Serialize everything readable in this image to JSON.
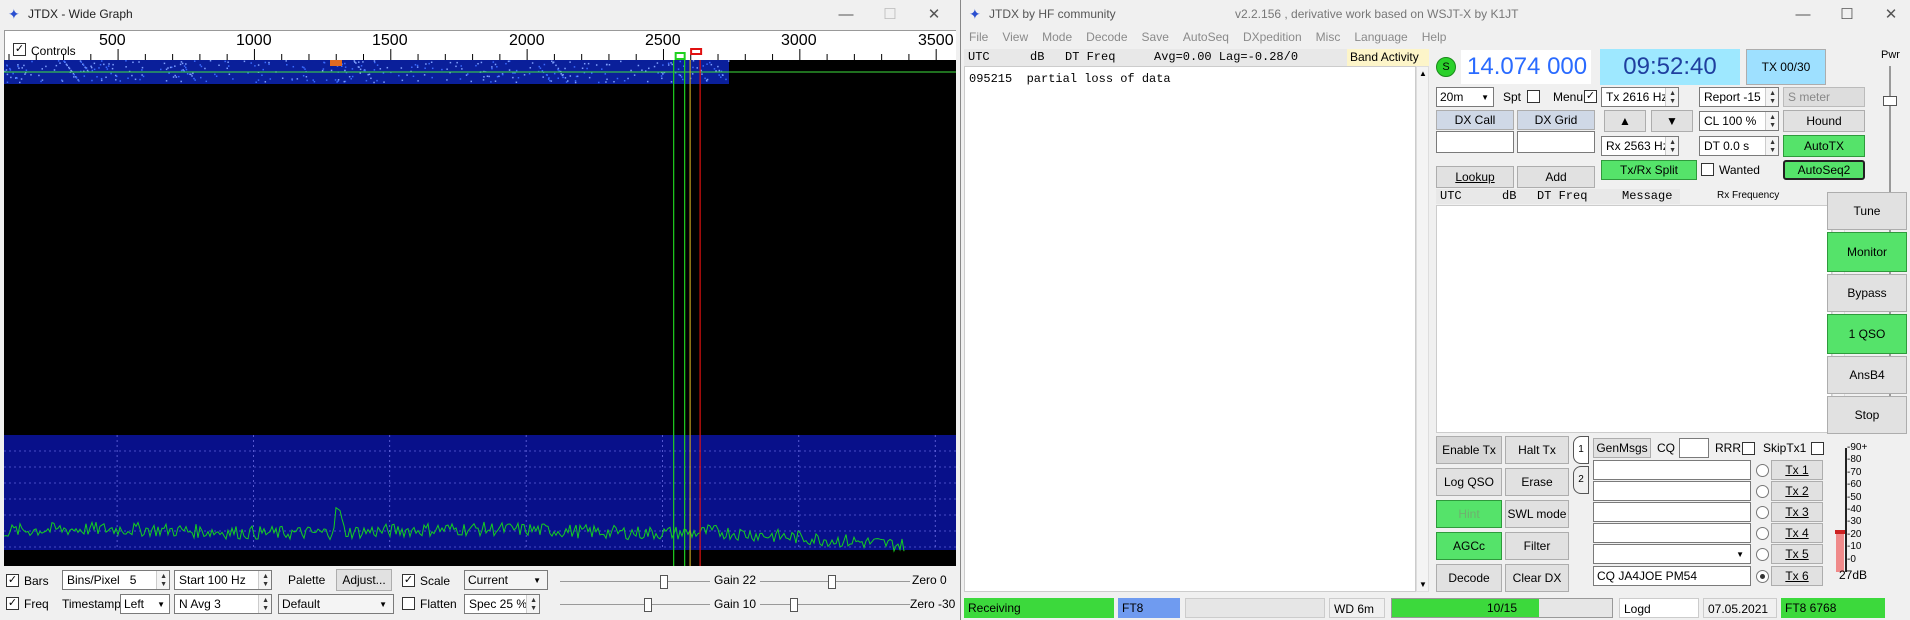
{
  "wide_graph": {
    "title": "JTDX - Wide Graph",
    "controls_label": "Controls",
    "freq_ticks": [
      "500",
      "1000",
      "1500",
      "2000",
      "2500",
      "3000",
      "3500"
    ],
    "bars_label": "Bars",
    "freq_label": "Freq",
    "bins_label": "Bins/Pixel",
    "bins_value": "5",
    "start_value": "Start 100 Hz",
    "timestamp_label": "Timestamp",
    "timestamp_value": "Left",
    "navg_value": "N Avg 3",
    "palette_label": "Palette",
    "adjust_button": "Adjust...",
    "palette_value": "Default",
    "scale_label": "Scale",
    "flatten_label": "Flatten",
    "current_value": "Current",
    "spec_value": "Spec 25 %",
    "gain1_label": "Gain 22",
    "zero1_label": "Zero 0",
    "gain2_label": "Gain 10",
    "zero2_label": "Zero -30",
    "colors": {
      "waterfall": "#0a1f9a",
      "spectrum": "#14d01f",
      "rx_marker": "#1fd01f",
      "tx_marker": "#e01010"
    }
  },
  "main": {
    "title": "JTDX by HF community",
    "subtitle": "v2.2.156 , derivative work based on WSJT-X by K1JT",
    "menu": [
      "File",
      "View",
      "Mode",
      "Decode",
      "Save",
      "AutoSeq",
      "DXpedition",
      "Misc",
      "Language",
      "Help"
    ],
    "band_header": {
      "utc": "UTC",
      "db": "dB",
      "dt_freq": "DT Freq",
      "avg": "Avg=0.00 Lag=-0.28/0",
      "band_activity": "Band Activity"
    },
    "band_lines": [
      "095215  partial loss of data"
    ],
    "rx_header": {
      "utc": "UTC",
      "db": "dB",
      "dt_freq": "DT Freq",
      "message": "Message",
      "rx_frequency": "Rx Frequency"
    },
    "s_icon": "S",
    "frequency": "14.074 000",
    "clock": "09:52:40",
    "tx_button": "TX 00/30",
    "pwr_label": "Pwr",
    "band_value": "20m",
    "spt_label": "Spt",
    "menu_label": "Menu",
    "tx_freq": "Tx  2616  Hz",
    "report": "Report -15",
    "smeter_label": "S meter",
    "cl": "CL  100 %",
    "hound": "Hound",
    "rx_freq": "Rx  2563  Hz",
    "dt": "DT 0.0 s",
    "autotx": "AutoTX",
    "autoseq2": "AutoSeq2",
    "txrx_split": "Tx/Rx Split",
    "wanted_label": "Wanted",
    "dx_call_label": "DX Call",
    "dx_grid_label": "DX Grid",
    "lookup": "Lookup",
    "add": "Add",
    "right_buttons": [
      "Tune",
      "Monitor",
      "Bypass",
      "1 QSO",
      "AnsB4",
      "Stop"
    ],
    "left_buttons": [
      "Enable Tx",
      "Halt Tx",
      "Log QSO",
      "Erase",
      "Hint",
      "SWL mode",
      "AGCc",
      "Filter",
      "Decode",
      "Clear DX"
    ],
    "tab1": "1",
    "tab2": "2",
    "genmsgs": "GenMsgs",
    "cq_label": "CQ",
    "rrr_label": "RRR",
    "skiptx1_label": "SkipTx1",
    "tx_buttons": [
      "Tx 1",
      "Tx 2",
      "Tx 3",
      "Tx 4",
      "Tx 5",
      "Tx 6"
    ],
    "tx6_message": "CQ JA4JOE PM54",
    "meter_ticks": [
      "90+",
      "80",
      "70",
      "60",
      "50",
      "40",
      "30",
      "20",
      "10",
      "0"
    ],
    "meter_db": "27dB",
    "status": {
      "receiving": "Receiving",
      "mode": "FT8",
      "wd": "WD 6m",
      "progress": "10/15",
      "progress_fraction": 0.667,
      "logd": "Logd",
      "date": "07.05.2021",
      "ft8_count": "FT8  6768"
    }
  }
}
